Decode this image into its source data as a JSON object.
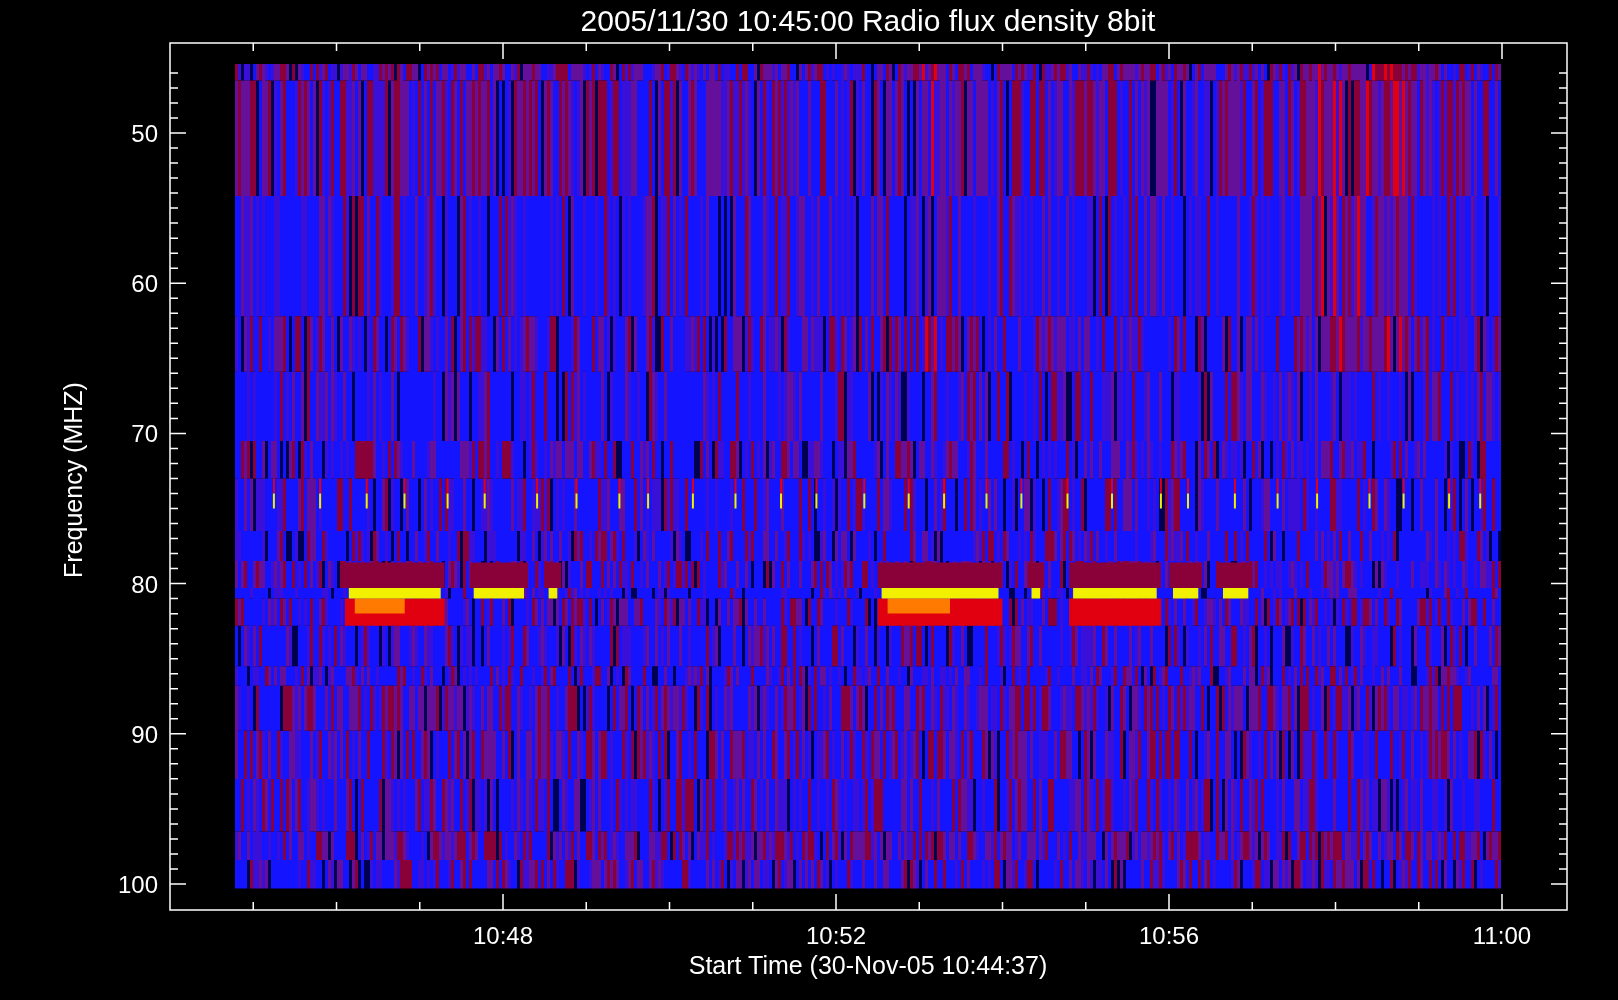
{
  "title": "2005/11/30 10:45:00 Radio flux density 8bit",
  "y_axis": {
    "label": "Frequency (MHZ)",
    "ticks": [
      "50",
      "60",
      "70",
      "80",
      "90",
      "100"
    ]
  },
  "x_axis": {
    "label": "Start Time (30-Nov-05 10:44:37)",
    "ticks": [
      "10:48",
      "10:52",
      "10:56",
      "11:00"
    ]
  }
}
